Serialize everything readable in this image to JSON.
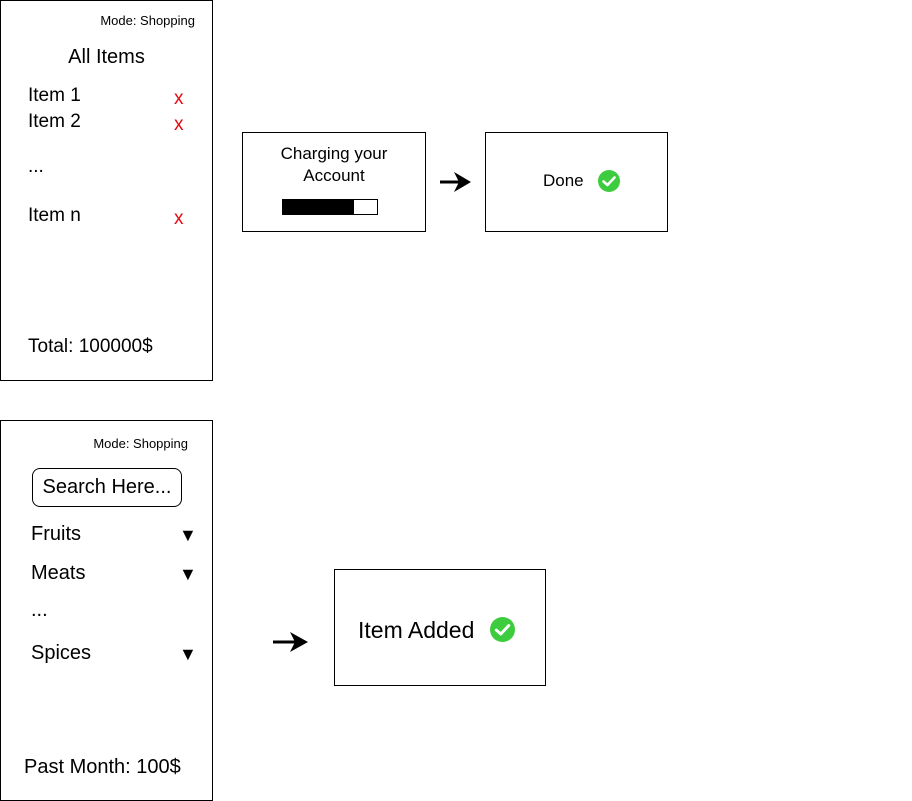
{
  "cart_panel": {
    "mode_label": "Mode: Shopping",
    "title": "All Items",
    "items": [
      {
        "label": "Item 1",
        "remove": "x"
      },
      {
        "label": "Item 2",
        "remove": "x"
      },
      {
        "label": "Item n",
        "remove": "x"
      }
    ],
    "ellipsis": "...",
    "total": "Total: 100000$"
  },
  "charging_popup": {
    "message": "Charging your Account",
    "progress": 0.75
  },
  "done_popup": {
    "label": "Done"
  },
  "search_panel": {
    "mode_label": "Mode: Shopping",
    "search_placeholder": "Search Here...",
    "categories": [
      {
        "label": "Fruits",
        "caret": "▼"
      },
      {
        "label": "Meats",
        "caret": "▼"
      },
      {
        "label": "Spices",
        "caret": "▼"
      }
    ],
    "ellipsis": "...",
    "past_month": "Past Month: 100$"
  },
  "item_added_popup": {
    "label": "Item Added"
  },
  "colors": {
    "remove": "#e8070f",
    "success": "#3dcc3d"
  }
}
